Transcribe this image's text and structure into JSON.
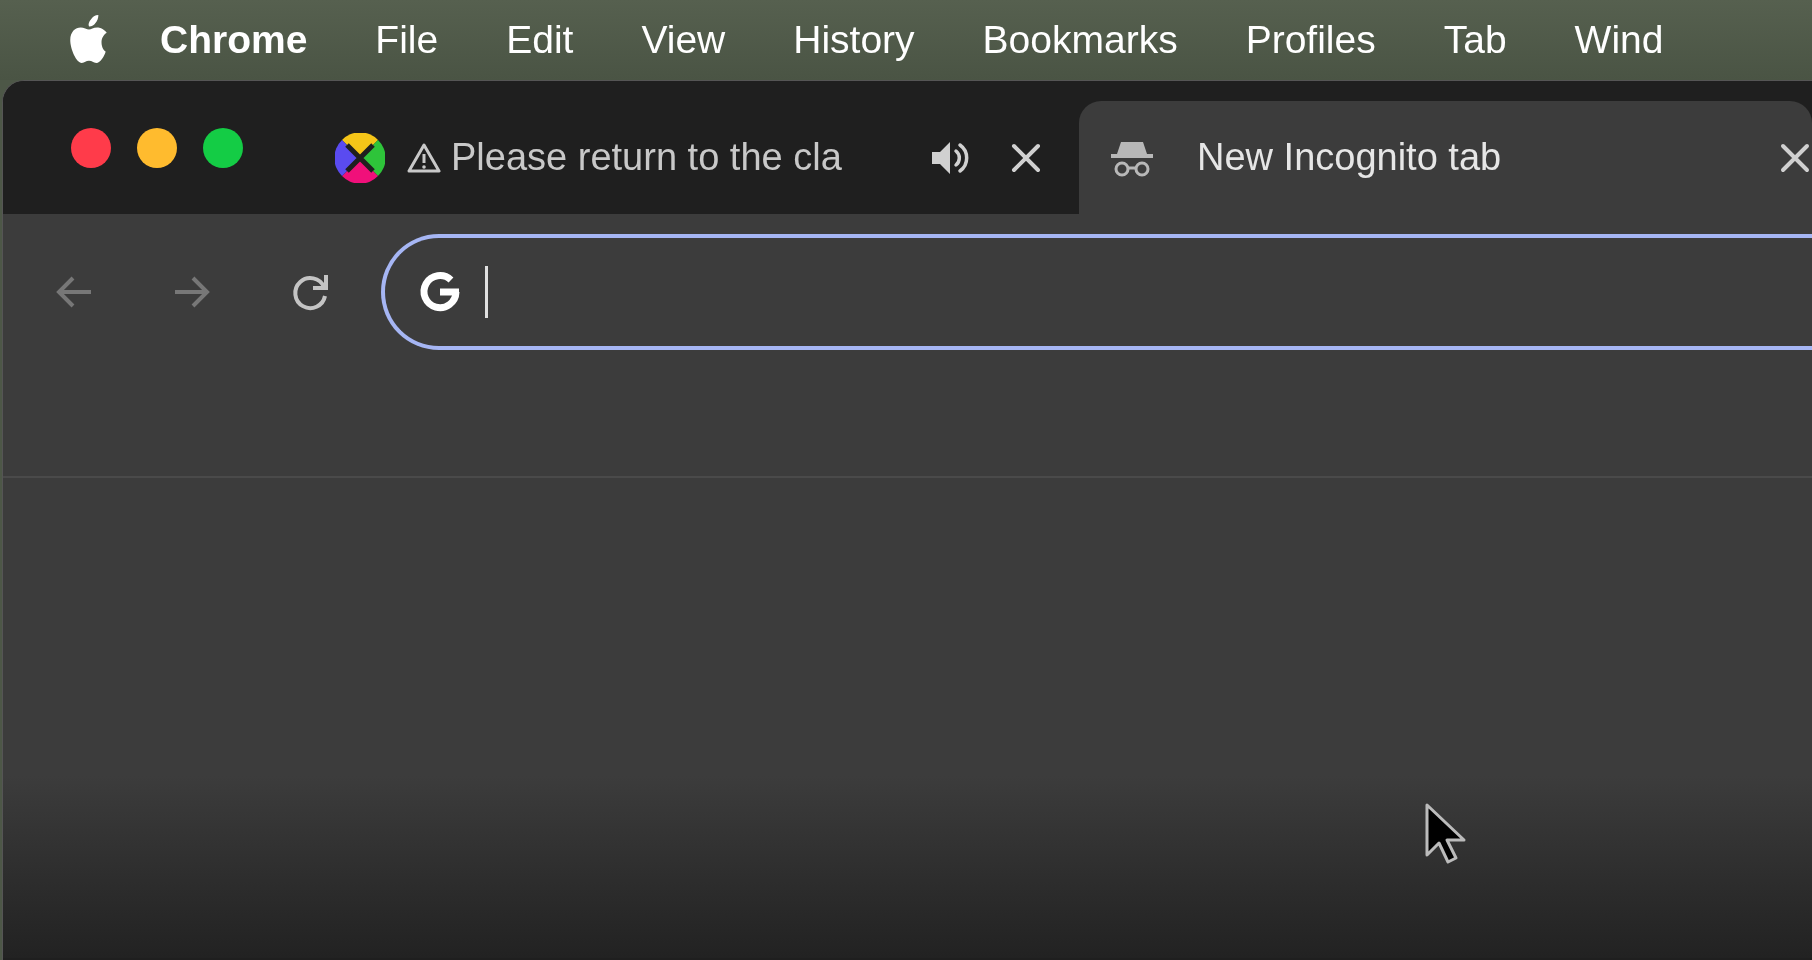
{
  "menu_bar": {
    "app_name": "Chrome",
    "items": [
      "File",
      "Edit",
      "View",
      "History",
      "Bookmarks",
      "Profiles",
      "Tab",
      "Wind"
    ]
  },
  "tabs": [
    {
      "kind": "site",
      "title": "Please return to the cla",
      "selected": false,
      "warning": true,
      "audio": true
    },
    {
      "kind": "incognito",
      "title": "New Incognito tab",
      "selected": true,
      "warning": false,
      "audio": false
    }
  ],
  "nav_buttons": [
    {
      "kind": "back",
      "disabled": true
    },
    {
      "kind": "forward",
      "disabled": true
    },
    {
      "kind": "reload",
      "disabled": false
    }
  ],
  "omnibox": {
    "focused": true
  }
}
